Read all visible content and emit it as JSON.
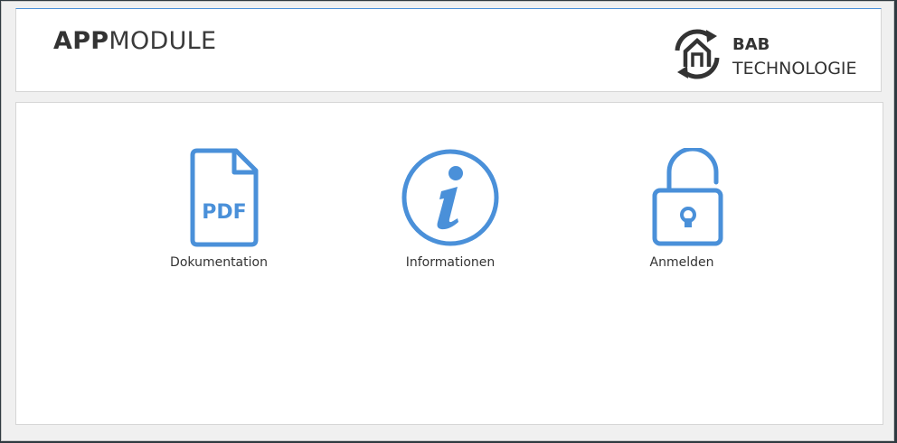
{
  "header": {
    "title_bold": "APP",
    "title_light": "MODULE",
    "logo": {
      "line1": "BAB",
      "line2": "TECHNOLOGIE",
      "icon": "house-refresh-icon"
    }
  },
  "tiles": [
    {
      "label": "Dokumentation",
      "icon": "pdf-document-icon",
      "icon_text": "PDF"
    },
    {
      "label": "Informationen",
      "icon": "info-circle-icon"
    },
    {
      "label": "Anmelden",
      "icon": "unlocked-padlock-icon"
    }
  ],
  "colors": {
    "accent": "#4a90d9",
    "text": "#333333",
    "panel_border": "#d6d6d6",
    "background": "#f0f0f0"
  }
}
